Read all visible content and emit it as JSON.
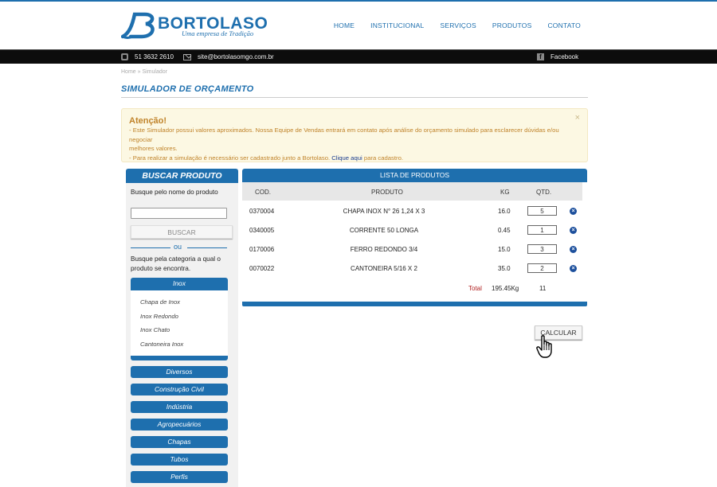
{
  "header": {
    "logo_name": "BORTOLASO",
    "logo_tagline": "Uma empresa de Tradição",
    "nav": [
      "HOME",
      "INSTITUCIONAL",
      "SERVIÇOS",
      "PRODUTOS",
      "CONTATO"
    ]
  },
  "contact": {
    "phone": "51 3632 2610",
    "email": "site@bortolasomgo.com.br",
    "facebook": "Facebook"
  },
  "breadcrumb": "Home » Simulador",
  "page_title": "SIMULADOR DE ORÇAMENTO",
  "alert": {
    "title": "Atenção!",
    "line1": "- Este Simulador possui valores aproximados. Nossa Equipe de Vendas entrará em contato após análise do orçamento simulado para esclarecer dúvidas e/ou negociar",
    "line2": "melhores valores.",
    "line3_prefix": "- Para realizar a simulação é necessário ser cadastrado junto a Bortolaso.",
    "link": "Clique aqui",
    "line3_suffix": "para cadastro.",
    "close": "×"
  },
  "sidebar": {
    "title": "BUSCAR PRODUTO",
    "search_label": "Busque pelo nome do produto",
    "search_value": "",
    "search_button": "BUSCAR",
    "or": "ou",
    "category_label": "Busque pela categoria a qual o produto se encontra.",
    "open_category": {
      "name": "Inox",
      "items": [
        "Chapa de Inox",
        "Inox Redondo",
        "Inox Chato",
        "Cantoneira Inox"
      ]
    },
    "categories": [
      "Diversos",
      "Construção Civil",
      "Indústria",
      "Agropecuários",
      "Chapas",
      "Tubos",
      "Perfis"
    ]
  },
  "products": {
    "title": "LISTA DE PRODUTOS",
    "columns": {
      "cod": "COD.",
      "produto": "PRODUTO",
      "kg": "KG",
      "qtd": "QTD."
    },
    "rows": [
      {
        "cod": "0370004",
        "produto": "CHAPA INOX N° 26 1,24 X 3",
        "kg": "16.0",
        "qtd": "5"
      },
      {
        "cod": "0340005",
        "produto": "CORRENTE 50 LONGA",
        "kg": "0.45",
        "qtd": "1"
      },
      {
        "cod": "0170006",
        "produto": "FERRO REDONDO 3/4",
        "kg": "15.0",
        "qtd": "3"
      },
      {
        "cod": "0070022",
        "produto": "CANTONEIRA 5/16 X 2",
        "kg": "35.0",
        "qtd": "2"
      }
    ],
    "total_label": "Total",
    "total_kg": "195.45Kg",
    "total_qty": "11",
    "calculate_button": "CALCULAR"
  },
  "colors": {
    "brand_blue": "#1e6fae",
    "alert_text": "#c0832a",
    "alert_bg": "#fcf8e3",
    "total_red": "#b02020"
  }
}
